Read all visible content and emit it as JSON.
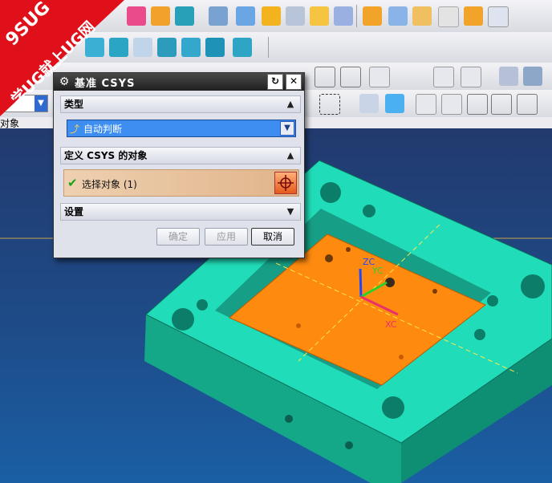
{
  "watermark": {
    "line1": "9SUG",
    "line2": "学UG就上UG网"
  },
  "dialog": {
    "title": "基准 CSYS",
    "sections": {
      "type": {
        "label": "类型",
        "selected": "自动判断"
      },
      "objects": {
        "label": "定义 CSYS 的对象",
        "select_label": "选择对象 (1)"
      },
      "settings": {
        "label": "设置"
      }
    },
    "buttons": {
      "ok": "确定",
      "apply": "应用",
      "cancel": "取消"
    }
  },
  "statusbar": {
    "left_text": "对象"
  },
  "viewport": {
    "axes": {
      "zc": "ZC",
      "yc": "YC",
      "xc": "XC"
    }
  },
  "colors": [
    "#ff0000",
    "#ff00ff",
    "#ff8c00",
    "#ffff00",
    "#c8ff00",
    "#00ff00",
    "#00a030",
    "#00ffff",
    "#00b0ff",
    "#0000ff",
    "#8040ff"
  ]
}
